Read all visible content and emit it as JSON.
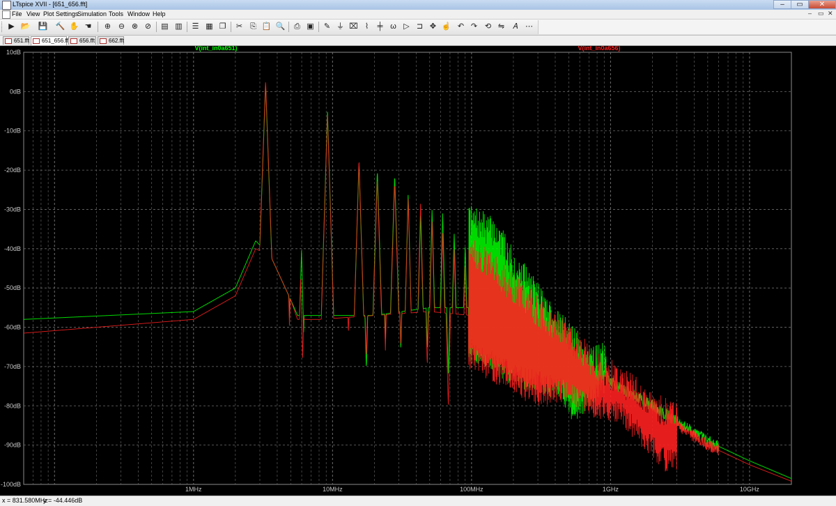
{
  "window": {
    "title": "LTspice XVII - [651_656.fft]"
  },
  "menu": {
    "items": [
      "File",
      "View",
      "Plot Settings",
      "Simulation",
      "Tools",
      "Window",
      "Help"
    ]
  },
  "toolbar": {
    "icons": [
      "run-icon",
      "open-icon",
      "save-icon",
      "control-panel-icon",
      "halt-icon",
      "pan-icon",
      "zoom-in-icon",
      "zoom-out-icon",
      "zoom-full-icon",
      "zoom-cancel-icon",
      "autorange-icon",
      "autorange-y-icon",
      "tile-horizontal-icon",
      "tile-vertical-icon",
      "cascade-icon",
      "cut-icon",
      "copy-icon",
      "paste-icon",
      "find-icon",
      "print-icon",
      "print-preview-icon",
      "wire-icon",
      "ground-icon",
      "label-icon",
      "resistor-icon",
      "capacitor-icon",
      "inductor-icon",
      "diode-icon",
      "component-icon",
      "move-icon",
      "drag-icon",
      "undo-icon",
      "redo-icon",
      "rotate-icon",
      "mirror-icon",
      "text-icon",
      "spice-directive-icon"
    ]
  },
  "tabs": [
    {
      "label": "651.fft",
      "active": false
    },
    {
      "label": "651_656.fft",
      "active": true
    },
    {
      "label": "656.fft",
      "active": false
    },
    {
      "label": "662.fft",
      "active": false
    }
  ],
  "colors": {
    "background": "#000000",
    "grid": "#6e6e6e",
    "axis_text": "#c8c8c8",
    "trace1": "#00ff00",
    "trace2": "#ff2020"
  },
  "chart_data": {
    "type": "line",
    "x_scale": "log",
    "x_unit": "Hz",
    "xlim": [
      60000,
      20000000000
    ],
    "ylim": [
      -100,
      10
    ],
    "y_unit": "dB",
    "x_ticks": [
      {
        "value": 1000000,
        "label": "1MHz"
      },
      {
        "value": 10000000,
        "label": "10MHz"
      },
      {
        "value": 100000000,
        "label": "100MHz"
      },
      {
        "value": 1000000000,
        "label": "1GHz"
      },
      {
        "value": 10000000000,
        "label": "10GHz"
      }
    ],
    "y_ticks": [
      {
        "value": 10,
        "label": "10dB"
      },
      {
        "value": 0,
        "label": "0dB"
      },
      {
        "value": -10,
        "label": "-10dB"
      },
      {
        "value": -20,
        "label": "-20dB"
      },
      {
        "value": -30,
        "label": "-30dB"
      },
      {
        "value": -40,
        "label": "-40dB"
      },
      {
        "value": -50,
        "label": "-50dB"
      },
      {
        "value": -60,
        "label": "-60dB"
      },
      {
        "value": -70,
        "label": "-70dB"
      },
      {
        "value": -80,
        "label": "-80dB"
      },
      {
        "value": -90,
        "label": "-90dB"
      },
      {
        "value": -100,
        "label": "-100dB"
      }
    ],
    "grid": true,
    "series": [
      {
        "name": "V(int_in0a651)",
        "color": "#00ff00",
        "base": [
          [
            60000,
            -58
          ],
          [
            1000000,
            -56
          ],
          [
            2000000,
            -50
          ],
          [
            2800000,
            -38
          ],
          [
            3600000,
            -42
          ],
          [
            5000000,
            -53
          ],
          [
            5600000,
            -57
          ],
          [
            8000000,
            -57
          ],
          [
            20000000,
            -57
          ],
          [
            50000000,
            -55
          ],
          [
            100000000,
            -55
          ],
          [
            200000000,
            -58
          ],
          [
            400000000,
            -66
          ],
          [
            600000000,
            -70
          ],
          [
            1000000000,
            -74
          ],
          [
            2000000000,
            -80
          ],
          [
            5000000000,
            -89
          ],
          [
            10000000000,
            -94
          ],
          [
            20000000000,
            -98.5
          ]
        ],
        "peaks": [
          [
            3300000,
            2,
            0.014
          ],
          [
            6000000,
            -39,
            0.012
          ],
          [
            9200000,
            -5,
            0.012
          ],
          [
            15500000,
            -18,
            0.012
          ],
          [
            21000000,
            -20,
            0.012
          ],
          [
            28000000,
            -21,
            0.012
          ],
          [
            35000000,
            -26,
            0.01
          ],
          [
            43000000,
            -31,
            0.01
          ],
          [
            52000000,
            -30,
            0.01
          ],
          [
            62000000,
            -31,
            0.01
          ],
          [
            75000000,
            -36,
            0.01
          ],
          [
            90000000,
            -39,
            0.01
          ]
        ],
        "notches": [
          [
            4900000,
            -58,
            0.01
          ],
          [
            6200000,
            -62,
            0.01
          ],
          [
            13000000,
            -58,
            0.01
          ],
          [
            17500000,
            -71,
            0.01
          ],
          [
            24000000,
            -63,
            0.01
          ],
          [
            31000000,
            -66,
            0.01
          ],
          [
            48000000,
            -66,
            0.01
          ],
          [
            68000000,
            -72,
            0.01
          ]
        ],
        "band": {
          "from": 95000000,
          "to": 950000000,
          "peaks": [
            [
              100000000,
              -33
            ],
            [
              150000000,
              -36
            ],
            [
              200000000,
              -44
            ],
            [
              300000000,
              -52
            ],
            [
              400000000,
              -58
            ],
            [
              550000000,
              -64
            ],
            [
              800000000,
              -68
            ]
          ],
          "troughs": [
            [
              100000000,
              -66
            ],
            [
              200000000,
              -72
            ],
            [
              300000000,
              -74
            ],
            [
              450000000,
              -76
            ],
            [
              550000000,
              -82
            ],
            [
              700000000,
              -78
            ],
            [
              900000000,
              -74
            ]
          ]
        }
      },
      {
        "name": "V(int_in0a656)",
        "color": "#ff2020",
        "base": [
          [
            60000,
            -61.5
          ],
          [
            1000000,
            -58
          ],
          [
            2000000,
            -52
          ],
          [
            2800000,
            -40
          ],
          [
            3600000,
            -42
          ],
          [
            5000000,
            -53
          ],
          [
            5600000,
            -58
          ],
          [
            8000000,
            -58
          ],
          [
            20000000,
            -57
          ],
          [
            50000000,
            -56
          ],
          [
            100000000,
            -57
          ],
          [
            200000000,
            -60
          ],
          [
            400000000,
            -67
          ],
          [
            600000000,
            -71
          ],
          [
            1000000000,
            -75
          ],
          [
            2000000000,
            -81
          ],
          [
            5000000000,
            -90
          ],
          [
            10000000000,
            -95
          ],
          [
            20000000000,
            -99.2
          ]
        ],
        "peaks": [
          [
            3300000,
            3,
            0.014
          ],
          [
            6000000,
            -39,
            0.012
          ],
          [
            9200000,
            -6,
            0.012
          ],
          [
            15500000,
            -17,
            0.012
          ],
          [
            21000000,
            -22,
            0.012
          ],
          [
            28000000,
            -23,
            0.012
          ],
          [
            35000000,
            -27,
            0.01
          ],
          [
            43000000,
            -28,
            0.01
          ],
          [
            52000000,
            -33,
            0.01
          ],
          [
            62000000,
            -36,
            0.01
          ],
          [
            75000000,
            -40,
            0.01
          ],
          [
            90000000,
            -44,
            0.01
          ]
        ],
        "notches": [
          [
            4900000,
            -60,
            0.01
          ],
          [
            6100000,
            -68,
            0.01
          ],
          [
            13000000,
            -62,
            0.01
          ],
          [
            17500000,
            -68,
            0.01
          ],
          [
            24000000,
            -66,
            0.01
          ],
          [
            31000000,
            -65,
            0.01
          ],
          [
            48000000,
            -70,
            0.01
          ],
          [
            68000000,
            -80,
            0.01
          ]
        ],
        "band": {
          "from": 95000000,
          "to": 3000000000,
          "peaks": [
            [
              100000000,
              -40
            ],
            [
              200000000,
              -50
            ],
            [
              300000000,
              -56
            ],
            [
              500000000,
              -62
            ],
            [
              800000000,
              -70
            ],
            [
              1500000000,
              -76
            ],
            [
              2500000000,
              -82
            ]
          ],
          "troughs": [
            [
              100000000,
              -68
            ],
            [
              200000000,
              -74
            ],
            [
              300000000,
              -78
            ],
            [
              450000000,
              -76
            ],
            [
              700000000,
              -80
            ],
            [
              1200000000,
              -82
            ],
            [
              2500000000,
              -94
            ]
          ]
        }
      }
    ]
  },
  "status": {
    "x": "x = 831.580MHz",
    "y": "y = -44.446dB"
  }
}
